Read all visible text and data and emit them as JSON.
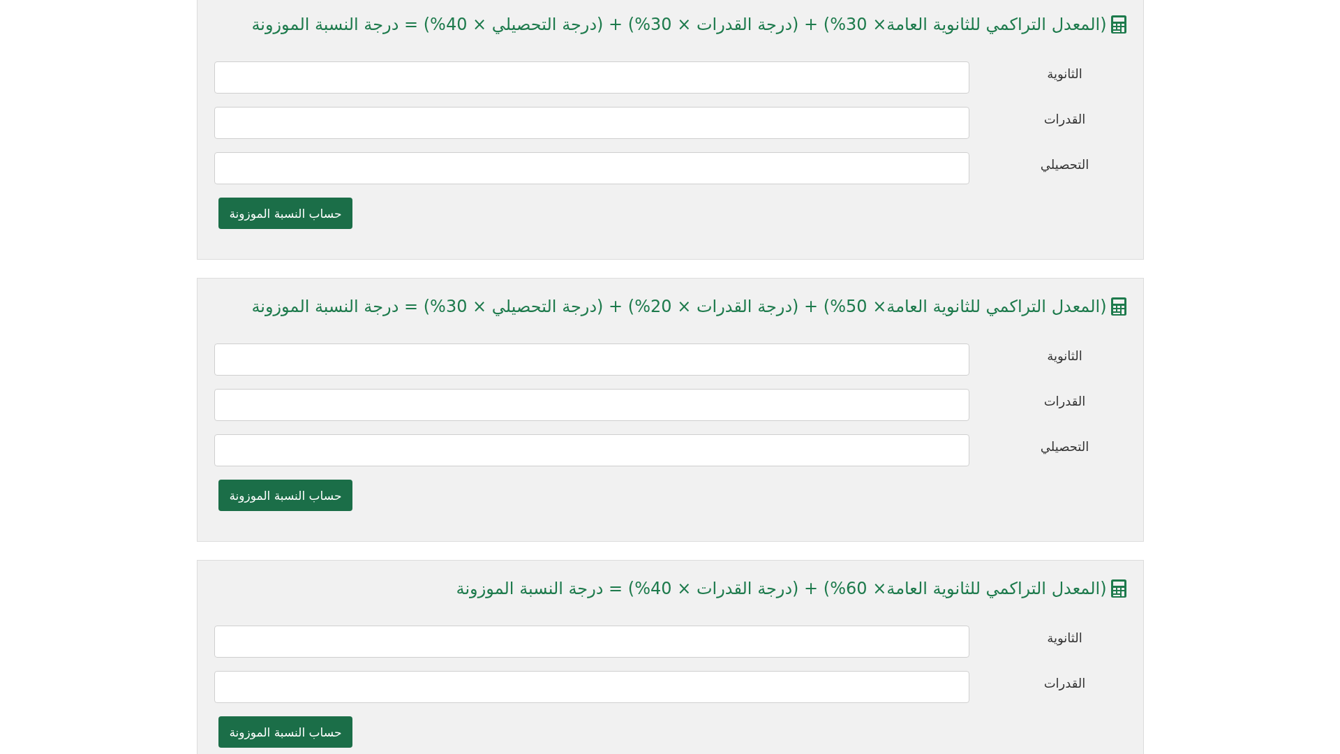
{
  "calculators": [
    {
      "title": "(المعدل التراكمي للثانوية العامة× 30%) + (درجة القدرات × 30%) + (درجة التحصيلي × 40%) = درجة النسبة الموزونة",
      "fields": [
        {
          "label": "الثانوية"
        },
        {
          "label": "القدرات"
        },
        {
          "label": "التحصيلي"
        }
      ],
      "button": "حساب النسبة الموزونة"
    },
    {
      "title": "(المعدل التراكمي للثانوية العامة× 50%) + (درجة القدرات × 20%) + (درجة التحصيلي × 30%) = درجة النسبة الموزونة",
      "fields": [
        {
          "label": "الثانوية"
        },
        {
          "label": "القدرات"
        },
        {
          "label": "التحصيلي"
        }
      ],
      "button": "حساب النسبة الموزونة"
    },
    {
      "title": "(المعدل التراكمي للثانوية العامة× 60%) + (درجة القدرات × 40%) = درجة النسبة الموزونة",
      "fields": [
        {
          "label": "الثانوية"
        },
        {
          "label": "القدرات"
        }
      ],
      "button": "حساب النسبة الموزونة"
    }
  ]
}
